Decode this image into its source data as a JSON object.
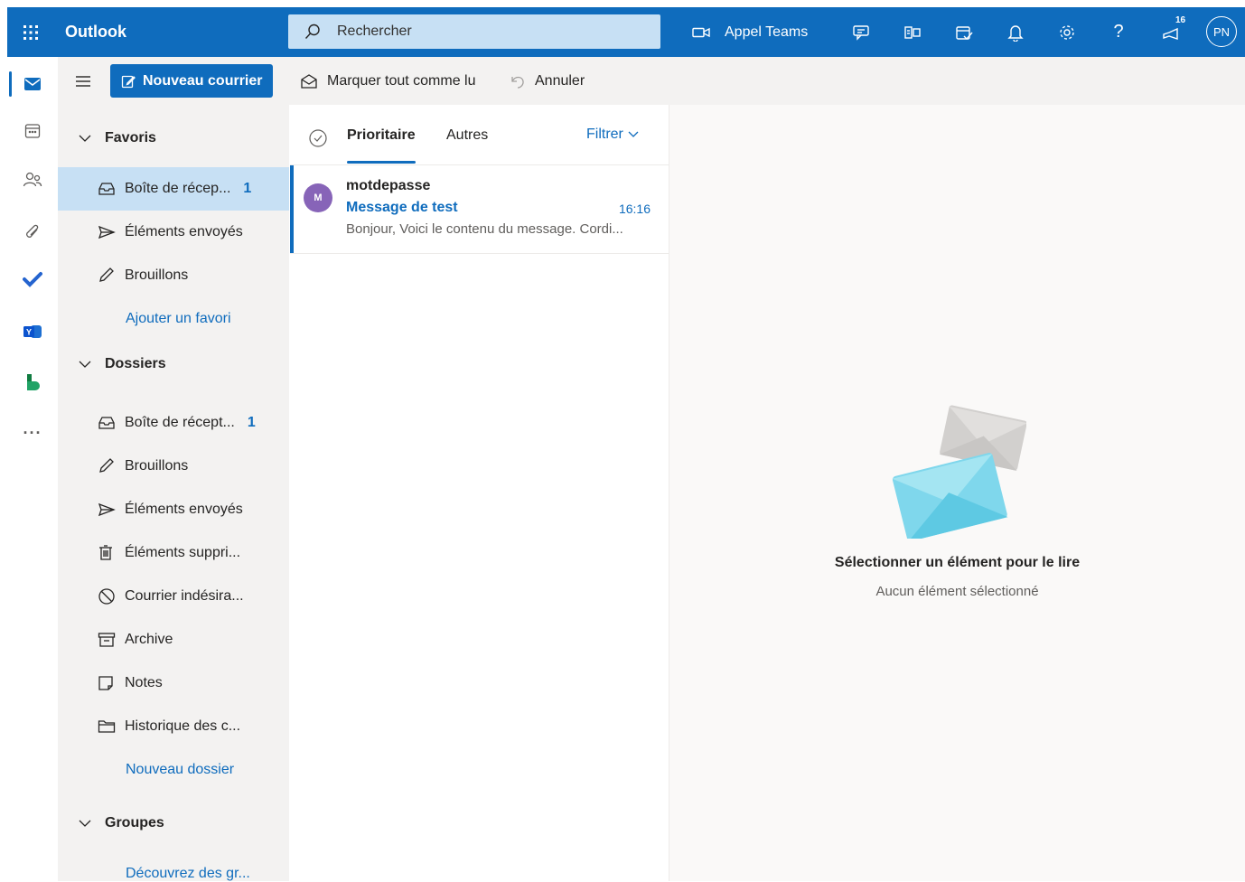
{
  "header": {
    "brand": "Outlook",
    "search_placeholder": "Rechercher",
    "teams_label": "Appel Teams",
    "notification_count": "16",
    "user_initials": "PN",
    "accent": "#0f6cbd"
  },
  "toolbar": {
    "new_mail": "Nouveau courrier",
    "mark_all_read": "Marquer tout comme lu",
    "undo": "Annuler"
  },
  "favorites": {
    "title": "Favoris",
    "items": [
      {
        "label": "Boîte de récep...",
        "count": "1"
      },
      {
        "label": "Éléments envoyés"
      },
      {
        "label": "Brouillons"
      }
    ],
    "add_link": "Ajouter un favori"
  },
  "folders": {
    "title": "Dossiers",
    "items": [
      {
        "label": "Boîte de récept...",
        "count": "1"
      },
      {
        "label": "Brouillons"
      },
      {
        "label": "Éléments envoyés"
      },
      {
        "label": "Éléments suppri..."
      },
      {
        "label": "Courrier indésira..."
      },
      {
        "label": "Archive"
      },
      {
        "label": "Notes"
      },
      {
        "label": "Historique des c..."
      }
    ],
    "new_folder_link": "Nouveau dossier"
  },
  "groups": {
    "title": "Groupes",
    "discover_link": "Découvrez des gr..."
  },
  "message_list": {
    "tabs": [
      "Prioritaire",
      "Autres"
    ],
    "filter": "Filtrer",
    "messages": [
      {
        "avatar": "M",
        "sender": "motdepasse",
        "subject": "Message de test",
        "time": "16:16",
        "preview": "Bonjour, Voici le contenu du message. Cordi..."
      }
    ]
  },
  "reading_pane": {
    "title": "Sélectionner un élément pour le lire",
    "subtitle": "Aucun élément sélectionné"
  }
}
